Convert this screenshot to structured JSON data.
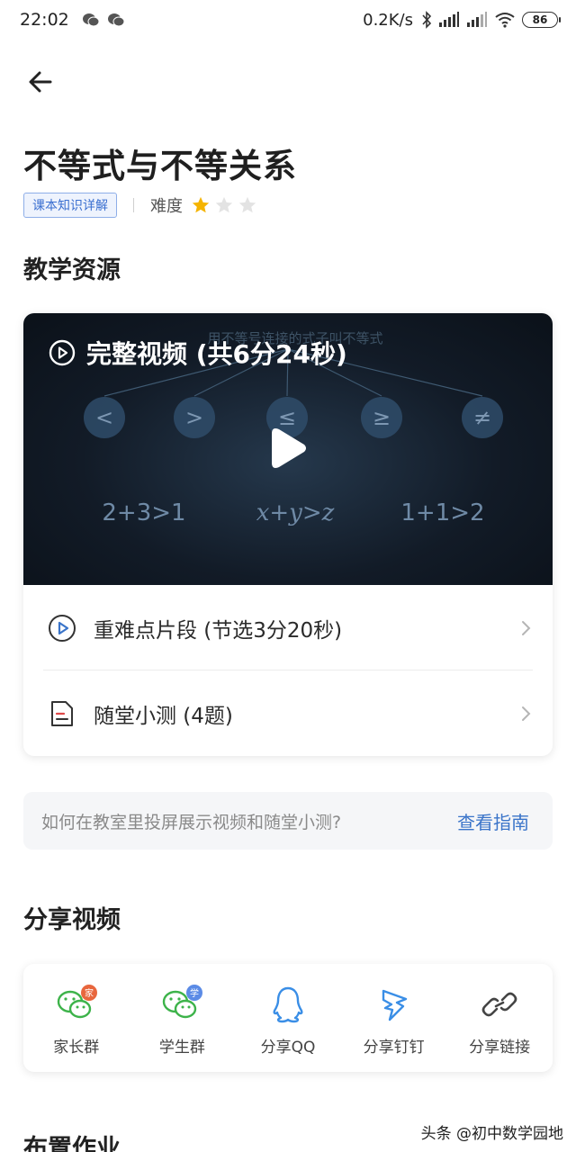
{
  "status_bar": {
    "time": "22:02",
    "network_speed": "0.2K/s",
    "battery": "86"
  },
  "header": {
    "title": "不等式与不等关系",
    "tag": "课本知识详解",
    "difficulty_label": "难度",
    "difficulty_stars": 1,
    "difficulty_max": 5
  },
  "resources": {
    "section_title": "教学资源",
    "video_title": "完整视频 (共6分24秒)",
    "video_thumb": {
      "caption": "用不等号连接的式子叫不等式",
      "symbols": [
        "<",
        ">",
        "≤",
        "≥",
        "≠"
      ],
      "examples": [
        "2+3>1",
        "x+y>z",
        "1+1>2"
      ]
    },
    "items": [
      {
        "label": "重难点片段 (节选3分20秒)",
        "icon": "play-circle-icon"
      },
      {
        "label": "随堂小测 (4题)",
        "icon": "document-icon"
      }
    ]
  },
  "guide": {
    "question": "如何在教室里投屏展示视频和随堂小测?",
    "link": "查看指南"
  },
  "share": {
    "section_title": "分享视频",
    "items": [
      {
        "label": "家长群",
        "badge": "家",
        "badge_color": "#e8663d",
        "icon": "wechat-icon"
      },
      {
        "label": "学生群",
        "badge": "学",
        "badge_color": "#5b8be6",
        "icon": "wechat-icon"
      },
      {
        "label": "分享QQ",
        "icon": "qq-icon"
      },
      {
        "label": "分享钉钉",
        "icon": "dingtalk-icon"
      },
      {
        "label": "分享链接",
        "icon": "link-icon"
      }
    ]
  },
  "next_section_title": "布置作业",
  "watermark": "头条 @初中数学园地",
  "colors": {
    "accent_blue": "#3a74c9",
    "star": "#f5b400",
    "wechat_green": "#3db34a"
  }
}
